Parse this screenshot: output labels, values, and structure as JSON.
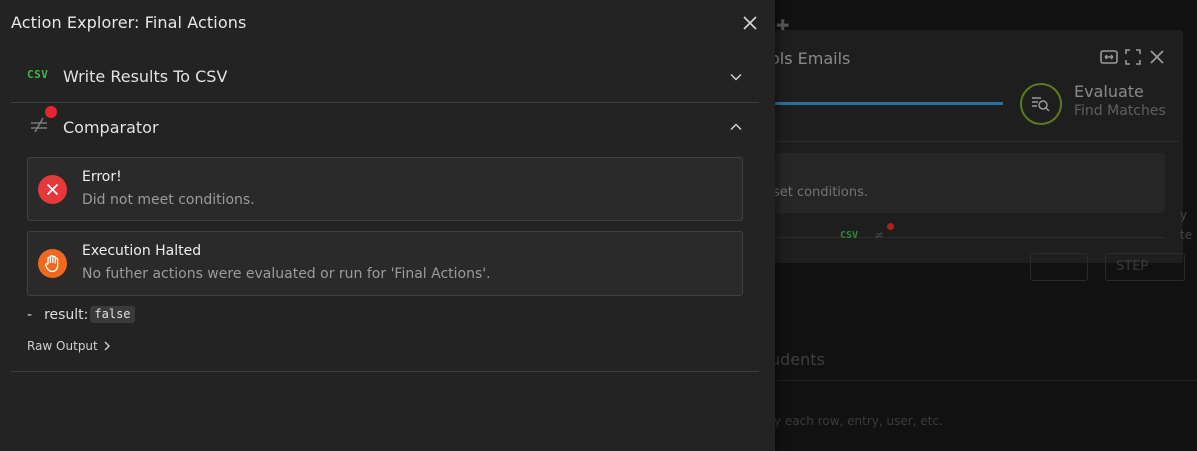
{
  "background": {
    "title_fragment": "ols Emails",
    "evaluate_title": "Evaluate",
    "evaluate_sub": "Find Matches",
    "box_text": "set conditions.",
    "csv_badge": "CSV",
    "toolbar_text": "STEP",
    "side_text_1": "y",
    "side_text_2": "te",
    "students": "udents",
    "hint": "fy each row, entry, user, etc."
  },
  "panel": {
    "title": "Action Explorer: Final Actions",
    "sections": [
      {
        "icon": "csv-icon",
        "badge": "CSV",
        "label": "Write Results To CSV",
        "expanded": false
      },
      {
        "icon": "comparator-icon",
        "label": "Comparator",
        "expanded": true,
        "has_error_dot": true
      }
    ],
    "cards": [
      {
        "icon": "error-icon",
        "title": "Error!",
        "message": "Did not meet conditions.",
        "color": "#e5383b"
      },
      {
        "icon": "hand-stop-icon",
        "title": "Execution Halted",
        "message": "No futher actions were evaluated or run for 'Final Actions'.",
        "color": "#f0691f"
      }
    ],
    "result": {
      "dash": "-",
      "key": "result:",
      "value": "false"
    },
    "raw_output": "Raw Output"
  }
}
